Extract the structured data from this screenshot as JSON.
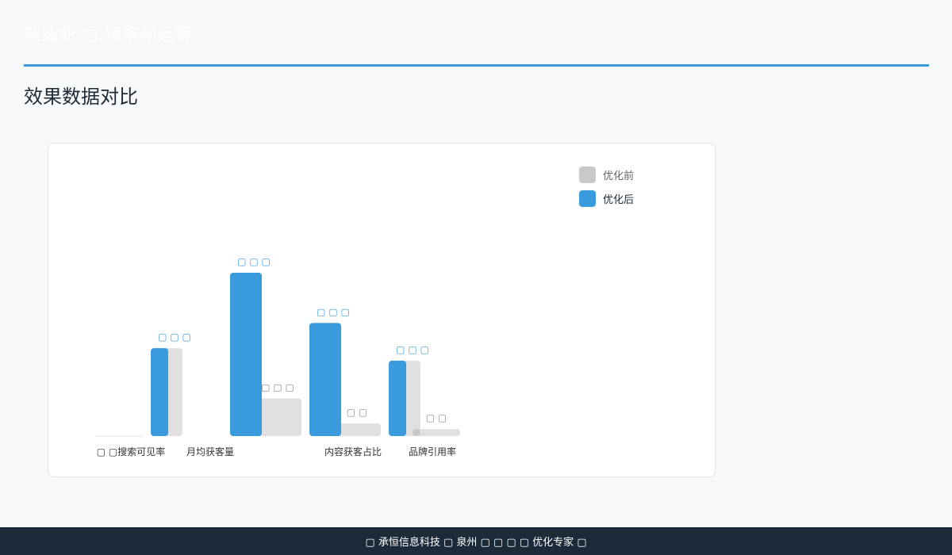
{
  "header": {
    "title": "制造业 ▢ 短视频运营"
  },
  "section": {
    "title": "效果数据对比"
  },
  "legend": [
    {
      "label": "优化前",
      "color": "#c9c9c9"
    },
    {
      "label": "优化后",
      "color": "#3a9bdc"
    }
  ],
  "chart_data": {
    "type": "bar",
    "categories": [
      "▢ ▢搜索可见率",
      "月均获客量",
      "内容获客占比",
      "品牌引用率",
      ""
    ],
    "series": [
      {
        "name": "优化前",
        "values": [
          0,
          48,
          16,
          9,
          0
        ],
        "labels": [
          "",
          "▢ ▢ ▢",
          "▢ ▢",
          "▢ ▢",
          ""
        ]
      },
      {
        "name": "优化后",
        "values": [
          112,
          208,
          144,
          96,
          0
        ],
        "labels": [
          "▢ ▢ ▢",
          "▢ ▢ ▢",
          "▢ ▢ ▢",
          "▢ ▢ ▢",
          ""
        ]
      }
    ],
    "ylim": [
      0,
      210
    ],
    "grid": false,
    "legend_position": "top-right"
  },
  "footer": {
    "text": "▢ 承恒信息科技 ▢ 泉州 ▢ ▢ ▢ ▢ 优化专家 ▢"
  }
}
